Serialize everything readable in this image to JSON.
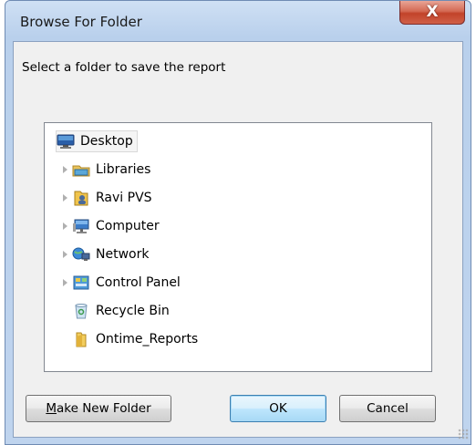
{
  "window": {
    "title": "Browse For Folder",
    "close_glyph": "X"
  },
  "prompt": "Select a folder to save the report",
  "tree": {
    "items": [
      {
        "label": "Desktop",
        "icon": "desktop-icon",
        "expandable": false,
        "selected": true
      },
      {
        "label": "Libraries",
        "icon": "libraries-icon",
        "expandable": true,
        "selected": false
      },
      {
        "label": "Ravi PVS",
        "icon": "user-folder-icon",
        "expandable": true,
        "selected": false
      },
      {
        "label": "Computer",
        "icon": "computer-icon",
        "expandable": true,
        "selected": false
      },
      {
        "label": "Network",
        "icon": "network-icon",
        "expandable": true,
        "selected": false
      },
      {
        "label": "Control Panel",
        "icon": "control-panel-icon",
        "expandable": true,
        "selected": false
      },
      {
        "label": "Recycle Bin",
        "icon": "recycle-bin-icon",
        "expandable": false,
        "selected": false
      },
      {
        "label": "Ontime_Reports",
        "icon": "folder-icon",
        "expandable": false,
        "selected": false
      }
    ]
  },
  "buttons": {
    "make_new_folder_accel": "M",
    "make_new_folder_rest": "ake New Folder",
    "ok": "OK",
    "cancel": "Cancel"
  }
}
